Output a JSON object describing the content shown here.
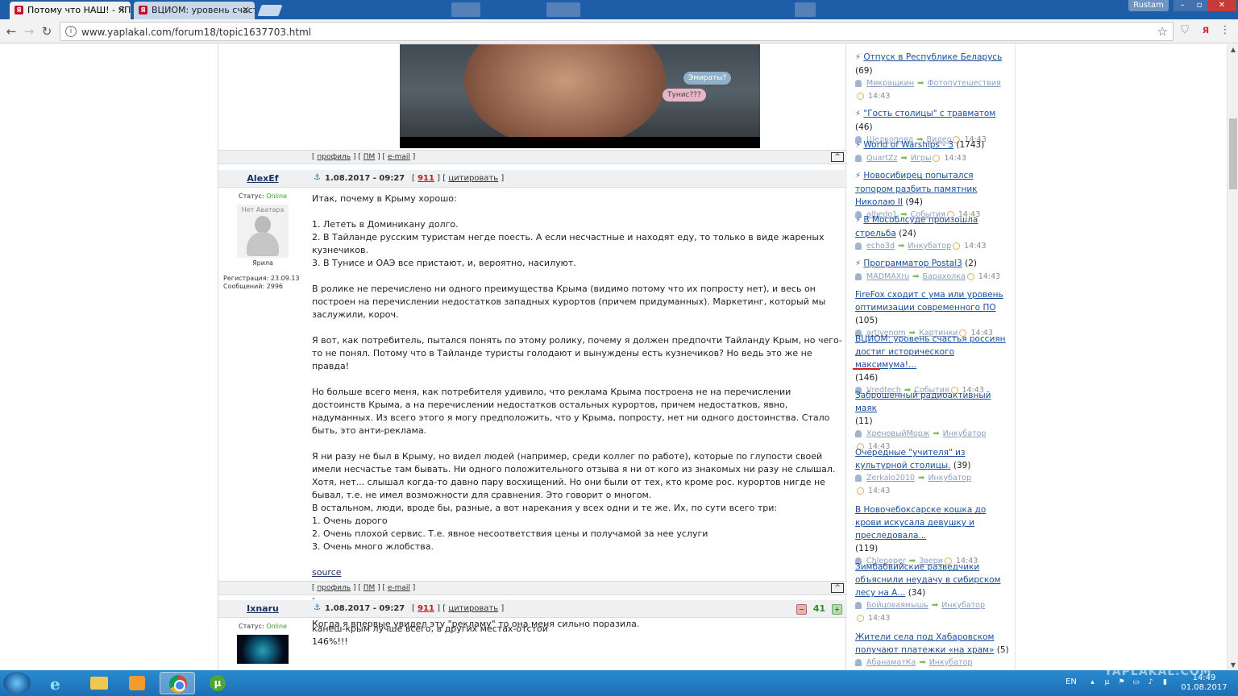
{
  "browser": {
    "tabs": [
      {
        "title": "Потому что НАШ! - ЯП..."
      },
      {
        "title": "ВЦИОМ: уровень счаст..."
      }
    ],
    "user_label": "Rustam",
    "url": "www.yaplakal.com/forum18/topic1637703.html"
  },
  "video": {
    "bubble1": "Эмираты?",
    "bubble2": "Тунис???"
  },
  "post_footer": {
    "profile": "профиль",
    "pm": "ПМ",
    "email": "e-mail",
    "up": "^"
  },
  "post1": {
    "author": "AlexEf",
    "date": "1.08.2017 - 09:27",
    "post_num": "911",
    "quote": "цитировать",
    "status_label": "Статус:",
    "status": "Online",
    "no_avatar": "Нет Аватара",
    "rank": "Ярила",
    "reg": "Регистрация: 23.09.13",
    "messages": "Сообщений: 2996",
    "paragraphs": [
      "Итак, почему в Крыму хорошо:",
      "1. Лететь в Доминикану долго.\n2. В Тайланде русским туристам негде поесть. А если несчастные и находят еду, то только в виде жареных кузнечиков.\n3. В Тунисе и ОАЭ все пристают, и, вероятно, насилуют.",
      "В ролике не перечислено ни одного преимущества Крыма (видимо потому что их попросту нет), и весь он построен на перечислении недостатков западных курортов (причем придуманных). Маркетинг, который мы заслужили, короч.",
      "Я вот, как потребитель, пытался понять по этому ролику, почему я должен предпочти Тайланду Крым, но чего-то не понял. Потому что в Тайланде туристы голодают и вынуждены есть кузнечиков? Но ведь это же не правда!",
      "Но больше всего меня, как потребителя удивило, что реклама Крыма построена не на перечислении достоинств Крыма, а на перечислении недостатков остальных курортов, причем недостатков, явно, надуманных. Из всего этого я могу предположить, что у Крыма, попросту, нет ни одного достоинства. Стало быть, это анти-реклама.",
      "Я ни разу не был в Крыму, но видел людей (например, среди коллег по работе), которые по глупости своей имели несчастье там бывать. Ни одного положительного отзыва я ни от кого из знакомых ни разу не слышал. Хотя, нет... слышал когда-то давно пару восхищений. Но они были от тех, кто кроме рос. курортов нигде не бывал, т.е. не имел возможности для сравнения. Это говорит о многом.\nВ остальном, люди, вроде бы, разные, а вот нарекания у всех одни и те же. Их, по сути всего три:\n1. Очень дорого\n2. Очень плохой сервис. Т.е. явное несоответствия цены и получамой за нее услуги\n3. Очень много жлобства."
    ],
    "source": "source",
    "dash": "-",
    "last": "Когда я впервые увидел эту \"рекламу\" то она меня сильно поразила."
  },
  "post2": {
    "author": "Ixnaru",
    "date": "1.08.2017 - 09:27",
    "post_num": "911",
    "quote": "цитировать",
    "rating": "41",
    "status_label": "Статус:",
    "status": "Online",
    "text": "канеш-крым лучше всего, в других местах-отстой\n146%!!!"
  },
  "sidebar": [
    {
      "title": "Отпуск в Республике Беларусь",
      "count": "(69)",
      "user": "Микращкин",
      "category": "Фотопутешествия",
      "time": "14:43",
      "bolt": true
    },
    {
      "title": "\"Гость столицы\" с травматом",
      "count": "(46)",
      "user": "Шелкопряд",
      "category": "Видео",
      "time": "14:43",
      "bolt": true
    },
    {
      "title": "World of Warships - 3",
      "count": "(1743)",
      "user": "QuartZz",
      "category": "Игры",
      "time": "14:43",
      "bolt": true
    },
    {
      "title": "Новосибирец попытался топором разбить памятник Николаю II",
      "count": "(94)",
      "user": "albedo1",
      "category": "События",
      "time": "14:43",
      "bolt": true
    },
    {
      "title": "В Мособлсуде произошла стрельба",
      "count": "(24)",
      "user": "echo3d",
      "category": "Инкубатор",
      "time": "14:43",
      "bolt": true
    },
    {
      "title": "Программатор Postal3",
      "count": "(2)",
      "user": "MADMAXru",
      "category": "Барахолка",
      "time": "14:43",
      "bolt": true
    },
    {
      "title": "FireFox сходит с ума или уровень оптимизации современного ПО",
      "count": "(105)",
      "user": "artivenom",
      "category": "Картинки",
      "time": "14:43",
      "bolt": false
    },
    {
      "title": "ВЦИОМ: уровень счастья россиян достиг исторического максимума!...",
      "count": "(146)",
      "user": "Vredtech",
      "category": "События",
      "time": "14:43",
      "bolt": false
    },
    {
      "title": "Заброшенный радиоактивный маяк",
      "count": "(11)",
      "user": "ХреновыйМорж",
      "category": "Инкубатор",
      "time": "14:43",
      "bolt": false
    },
    {
      "title": "Очередные \"учителя\" из культурной столицы.",
      "count": "(39)",
      "user": "Zerkalo2010",
      "category": "Инкубатор",
      "time": "14:43",
      "bolt": false
    },
    {
      "title": "В Новочебоксарске кошка до крови искусала девушку и преследовала...",
      "count": "(119)",
      "user": "Chlenoper",
      "category": "Звери",
      "time": "14:43",
      "bolt": false
    },
    {
      "title": "Зимбабвийские разведчики объяснили неудачу в сибирском лесу на А...",
      "count": "(34)",
      "user": "Бойцоваямышь",
      "category": "Инкубатор",
      "time": "14:43",
      "bolt": false
    },
    {
      "title": "Жители села под Хабаровском получают платежки «на храм»",
      "count": "(5)",
      "user": "АбанаматКа",
      "category": "Инкубатор",
      "time": "",
      "bolt": false
    }
  ],
  "taskbar": {
    "lang": "EN",
    "time": "14:49",
    "date": "01.08.2017",
    "watermark": "YAPLAKAL.COM"
  }
}
